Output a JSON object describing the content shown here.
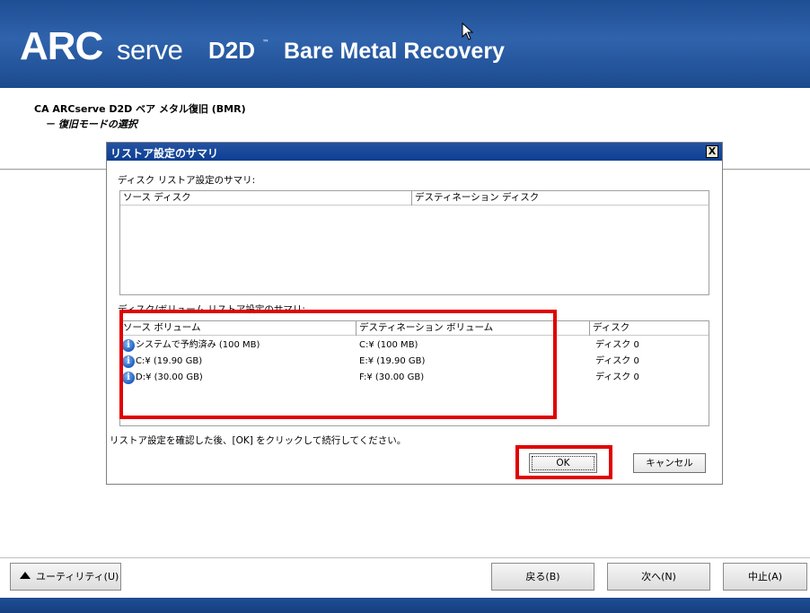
{
  "header": {
    "logo_arc": "ARC",
    "logo_serve": "serve",
    "logo_d2d": "D2D",
    "logo_tm": "™",
    "title": "Bare Metal Recovery"
  },
  "page": {
    "subtitle": "CA ARCserve D2D ベア メタル復旧 (BMR)",
    "step": "－ 復旧モードの選択"
  },
  "dialog": {
    "title": "リストア設定のサマリ",
    "close_label": "X",
    "disk_section_label": "ディスク リストア設定のサマリ:",
    "disk_table": {
      "columns": [
        "ソース ディスク",
        "デスティネーション ディスク"
      ],
      "rows": []
    },
    "volume_section_label": "ディスク/ボリューム リストア設定のサマリ:",
    "volume_table": {
      "columns": [
        "ソース ボリューム",
        "デスティネーション ボリューム",
        "ディスク"
      ],
      "rows": [
        {
          "icon": "info-icon",
          "source": "システムで予約済み (100 MB)",
          "dest": "C:¥ (100 MB)",
          "disk": "ディスク 0"
        },
        {
          "icon": "info-icon",
          "source": "C:¥ (19.90 GB)",
          "dest": "E:¥ (19.90 GB)",
          "disk": "ディスク 0"
        },
        {
          "icon": "info-icon",
          "source": "D:¥ (30.00 GB)",
          "dest": "F:¥ (30.00 GB)",
          "disk": "ディスク 0"
        }
      ]
    },
    "instruction": "リストア設定を確認した後、[OK] をクリックして続行してください。",
    "ok_label": "OK",
    "cancel_label": "キャンセル"
  },
  "footer": {
    "utility_label": "ユーティリティ(U)",
    "back_label": "戻る(B)",
    "next_label": "次へ(N)",
    "abort_label": "中止(A)"
  },
  "colors": {
    "banner": "#2f63ac",
    "highlight": "#e00000",
    "titlebar": "#0e3f92"
  }
}
